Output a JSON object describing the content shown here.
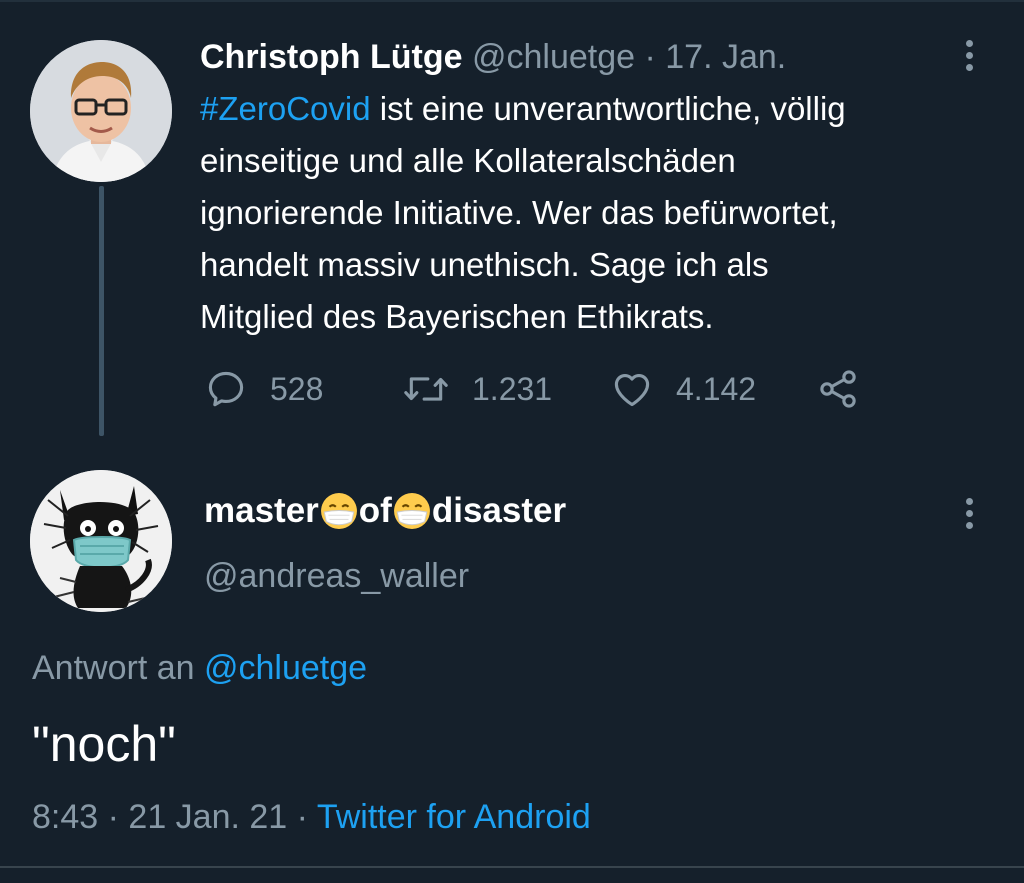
{
  "parent_tweet": {
    "name": "Christoph Lütge",
    "handle": "@chluetge",
    "separator": " · ",
    "date": "17. Jan.",
    "hashtag": "#ZeroCovid",
    "text_line1_rest": " ist eine unverantwortliche, völlig",
    "text_line2": "einseitige und alle Kollateralschäden",
    "text_line3": "ignorierende Initiative. Wer das befürwortet,",
    "text_line4": "handelt massiv unethisch. Sage ich als",
    "text_line5": "Mitglied des Bayerischen Ethikrats.",
    "replies": "528",
    "retweets": "1.231",
    "likes": "4.142",
    "icons": {
      "reply": "reply-icon",
      "retweet": "retweet-icon",
      "like": "heart-icon",
      "share": "share-icon",
      "more": "more-vertical-icon"
    }
  },
  "reply_tweet": {
    "name_part1": "master",
    "name_part2": "of",
    "name_part3": "disaster",
    "name_emoji": "face-with-medical-mask-emoji",
    "handle": "@andreas_waller",
    "reply_label": "Antwort an ",
    "reply_mention": "@chluetge",
    "text": "\"noch\"",
    "time": "8:43",
    "separator": " · ",
    "date": "21 Jan. 21",
    "separator2": " · ",
    "source": "Twitter for Android"
  },
  "colors": {
    "background": "#15202b",
    "secondary_text": "#8899a6",
    "link": "#1da1f2",
    "primary_text": "#ffffff"
  }
}
